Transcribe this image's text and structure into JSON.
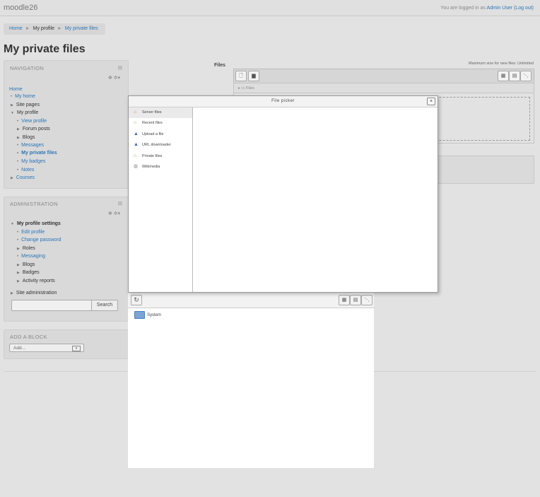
{
  "header": {
    "site_name": "moodle26",
    "login_prefix": "You are logged in as",
    "user_name": "Admin User",
    "logout": "(Log out)"
  },
  "breadcrumb": {
    "home": "Home",
    "my_profile": "My profile",
    "current": "My private files",
    "separator": "►"
  },
  "page": {
    "title": "My private files"
  },
  "navigation": {
    "title": "NAVIGATION",
    "home": "Home",
    "my_home": "My home",
    "site_pages": "Site pages",
    "my_profile": "My profile",
    "view_profile": "View profile",
    "forum_posts": "Forum posts",
    "blogs": "Blogs",
    "messages": "Messages",
    "my_private_files": "My private files",
    "my_badges": "My badges",
    "notes": "Notes",
    "courses": "Courses"
  },
  "administration": {
    "title": "ADMINISTRATION",
    "my_profile_settings": "My profile settings",
    "edit_profile": "Edit profile",
    "change_password": "Change password",
    "roles": "Roles",
    "messaging": "Messaging",
    "blogs": "Blogs",
    "badges": "Badges",
    "activity_reports": "Activity reports",
    "site_administration": "Site administration",
    "search_value": "",
    "search_button": "Search"
  },
  "add_block": {
    "title": "ADD A BLOCK",
    "selected": "Add..."
  },
  "filemanager": {
    "label": "Files",
    "max_size": "Maximum size for new files: Unlimited",
    "path_root": "Files"
  },
  "file_picker": {
    "title": "File picker",
    "close": "×",
    "repositories": [
      {
        "label": "Server files",
        "icon": "house-icon",
        "active": true
      },
      {
        "label": "Recent files",
        "icon": "house-icon",
        "active": false
      },
      {
        "label": "Upload a file",
        "icon": "upload-icon",
        "active": false
      },
      {
        "label": "URL downloader",
        "icon": "url-icon",
        "active": false
      },
      {
        "label": "Private files",
        "icon": "house-icon",
        "active": false
      },
      {
        "label": "Wikimedia",
        "icon": "wikimedia-icon",
        "active": false
      }
    ],
    "browser_folder": "System"
  },
  "colors": {
    "link": "#2b76b8",
    "background": "#e2e2e2",
    "block": "#d9d9d9"
  }
}
